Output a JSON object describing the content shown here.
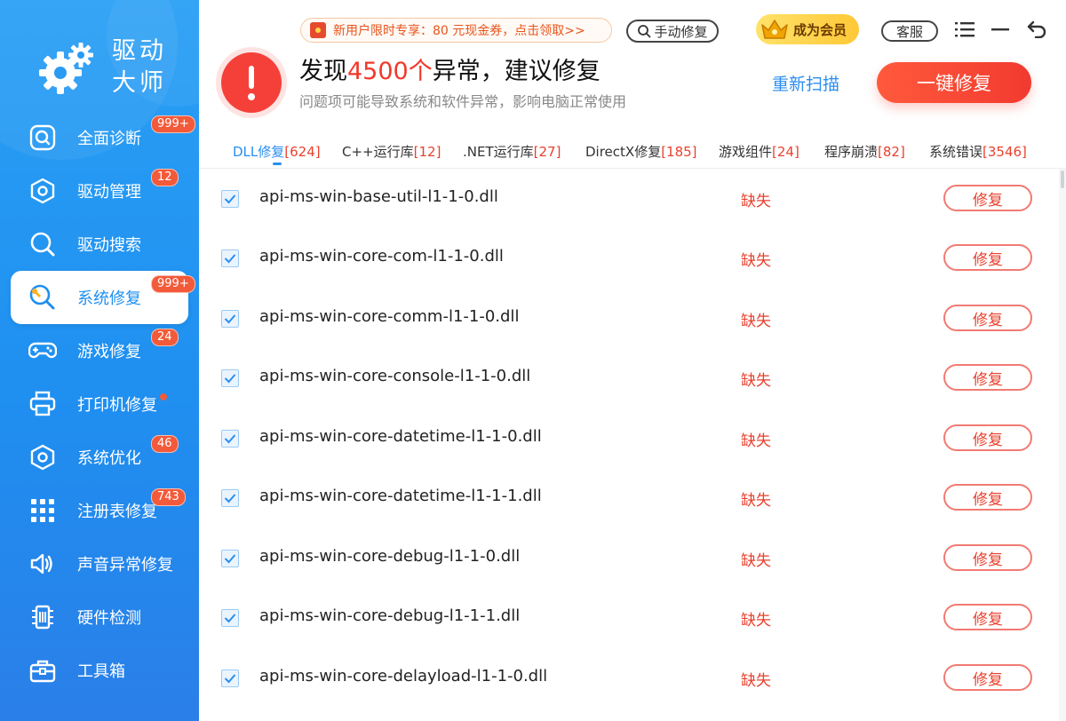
{
  "app": {
    "name_line1": "驱动",
    "name_line2": "大师"
  },
  "sidebar": {
    "items": [
      {
        "label": "全面诊断",
        "icon": "diagnosis-icon",
        "badge": "999+"
      },
      {
        "label": "驱动管理",
        "icon": "driver-manage-icon",
        "badge": "12"
      },
      {
        "label": "驱动搜索",
        "icon": "search-icon",
        "badge": ""
      },
      {
        "label": "系统修复",
        "icon": "system-repair-icon",
        "badge": "999+",
        "active": true
      },
      {
        "label": "游戏修复",
        "icon": "gamepad-icon",
        "badge": "24"
      },
      {
        "label": "打印机修复",
        "icon": "printer-icon",
        "badge": "",
        "dot": true
      },
      {
        "label": "系统优化",
        "icon": "optimize-icon",
        "badge": "46"
      },
      {
        "label": "注册表修复",
        "icon": "registry-icon",
        "badge": "743"
      },
      {
        "label": "声音异常修复",
        "icon": "speaker-icon",
        "badge": ""
      },
      {
        "label": "硬件检测",
        "icon": "hardware-icon",
        "badge": ""
      },
      {
        "label": "工具箱",
        "icon": "toolbox-icon",
        "badge": ""
      }
    ]
  },
  "topbar": {
    "promo": "新用户限时专享：80 元现金券，点击领取>>",
    "manual_repair": "手动修复",
    "vip": "成为会员",
    "service": "客服"
  },
  "header": {
    "title_prefix": "发现",
    "title_count": "4500个",
    "title_suffix": "异常，建议修复",
    "subtitle": "问题项可能导致系统和软件异常，影响电脑正常使用",
    "rescan": "重新扫描",
    "fix_all": "一键修复"
  },
  "tabs": [
    {
      "label": "DLL修复",
      "count": "[624]",
      "active": true
    },
    {
      "label": "C++运行库",
      "count": "[12]"
    },
    {
      "label": ".NET运行库",
      "count": "[27]"
    },
    {
      "label": "DirectX修复",
      "count": "[185]"
    },
    {
      "label": "游戏组件",
      "count": "[24]"
    },
    {
      "label": "程序崩溃",
      "count": "[82]"
    },
    {
      "label": "系统错误",
      "count": "[3546]"
    }
  ],
  "rows": [
    {
      "file": "api-ms-win-base-util-l1-1-0.dll",
      "status": "缺失",
      "action": "修复",
      "checked": true
    },
    {
      "file": "api-ms-win-core-com-l1-1-0.dll",
      "status": "缺失",
      "action": "修复",
      "checked": true
    },
    {
      "file": "api-ms-win-core-comm-l1-1-0.dll",
      "status": "缺失",
      "action": "修复",
      "checked": true
    },
    {
      "file": "api-ms-win-core-console-l1-1-0.dll",
      "status": "缺失",
      "action": "修复",
      "checked": true
    },
    {
      "file": "api-ms-win-core-datetime-l1-1-0.dll",
      "status": "缺失",
      "action": "修复",
      "checked": true
    },
    {
      "file": "api-ms-win-core-datetime-l1-1-1.dll",
      "status": "缺失",
      "action": "修复",
      "checked": true
    },
    {
      "file": "api-ms-win-core-debug-l1-1-0.dll",
      "status": "缺失",
      "action": "修复",
      "checked": true
    },
    {
      "file": "api-ms-win-core-debug-l1-1-1.dll",
      "status": "缺失",
      "action": "修复",
      "checked": true
    },
    {
      "file": "api-ms-win-core-delayload-l1-1-0.dll",
      "status": "缺失",
      "action": "修复",
      "checked": true
    }
  ],
  "colors": {
    "brand_blue": "#1f8ff0",
    "accent_red": "#f0382b",
    "vip_gold": "#ffc837"
  }
}
